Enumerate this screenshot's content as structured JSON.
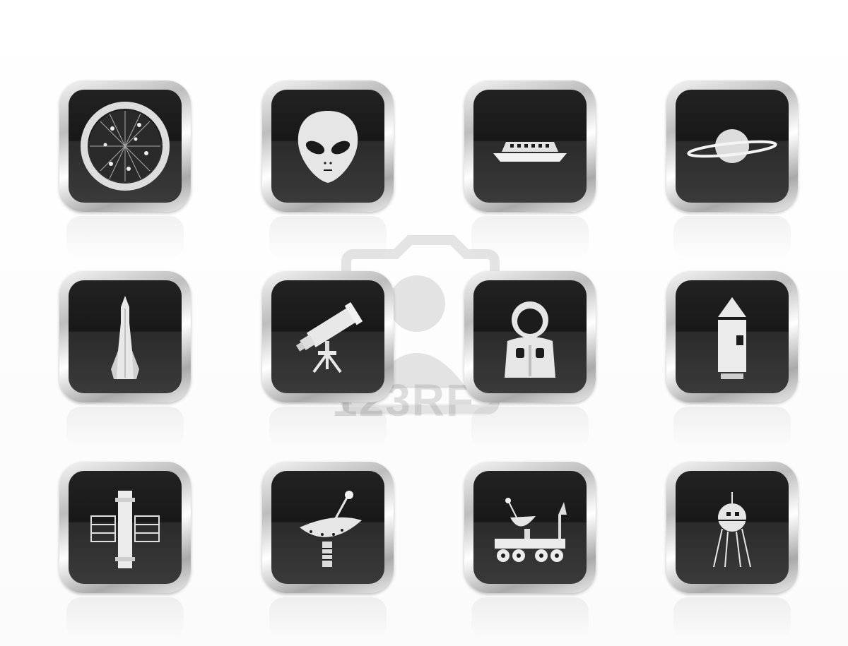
{
  "watermark": {
    "text": "123RF"
  },
  "icons": [
    {
      "name": "planet-globe-icon"
    },
    {
      "name": "alien-head-icon"
    },
    {
      "name": "flying-saucer-icon"
    },
    {
      "name": "ringed-planet-icon"
    },
    {
      "name": "rocket-icon"
    },
    {
      "name": "telescope-icon"
    },
    {
      "name": "astronaut-suit-icon"
    },
    {
      "name": "space-capsule-icon"
    },
    {
      "name": "space-telescope-satellite-icon"
    },
    {
      "name": "satellite-dish-icon"
    },
    {
      "name": "lunar-rover-icon"
    },
    {
      "name": "sputnik-lander-icon"
    }
  ],
  "colors": {
    "button_face": "#1c1c1c",
    "button_rim": "#c8c8c8",
    "glyph": "#ffffff",
    "background": "#ffffff"
  }
}
